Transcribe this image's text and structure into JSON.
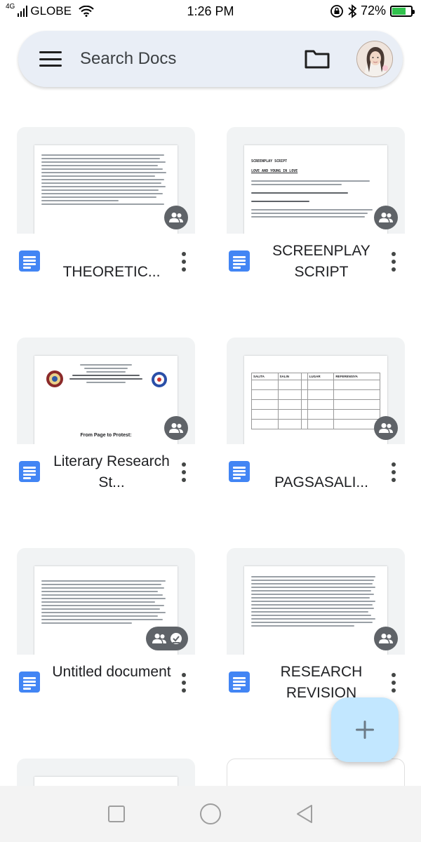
{
  "status_bar": {
    "network_label": "4G",
    "carrier": "GLOBE",
    "time": "1:26 PM",
    "battery_percent": "72%",
    "battery_level": 0.72,
    "icons": [
      "signal-icon",
      "wifi-icon",
      "rotation-lock-icon",
      "bluetooth-icon",
      "battery-icon"
    ]
  },
  "search": {
    "placeholder": "Search Docs",
    "menu_icon": "hamburger-menu-icon",
    "folder_icon": "folder-icon",
    "avatar_icon": "account-avatar"
  },
  "documents": [
    {
      "title": "THEORETIC...",
      "shared_icon": "shared-people-icon"
    },
    {
      "title": "SCREENPLAY SCRIPT",
      "shared_icon": "shared-people-icon",
      "preview_lines": [
        "SCREENPLAY SCRIPT",
        "LOVE AND YOUNG IN LOVE"
      ]
    },
    {
      "title": "Literary Research St...",
      "shared_icon": "shared-people-icon",
      "preview_lines": [
        "From Page to Protest:"
      ]
    },
    {
      "title": "PAGSASALI...",
      "shared_icon": "shared-people-icon",
      "preview_lines": [
        "SALITA",
        "SALIN",
        "LUGAR",
        "REFERENSIYA"
      ]
    },
    {
      "title": "Untitled document",
      "shared_icon": "shared-people-offline-icon"
    },
    {
      "title": "RESEARCH REVISION",
      "shared_icon": "shared-people-icon"
    }
  ],
  "fab": {
    "icon": "plus-icon"
  },
  "nav": {
    "icons": [
      "recent-apps-square-icon",
      "home-circle-icon",
      "back-triangle-icon"
    ]
  },
  "colors": {
    "docs_blue": "#4285f4",
    "fab_bg": "#c2e7ff",
    "search_bg": "#e9eef6",
    "battery_green": "#31c24d"
  }
}
